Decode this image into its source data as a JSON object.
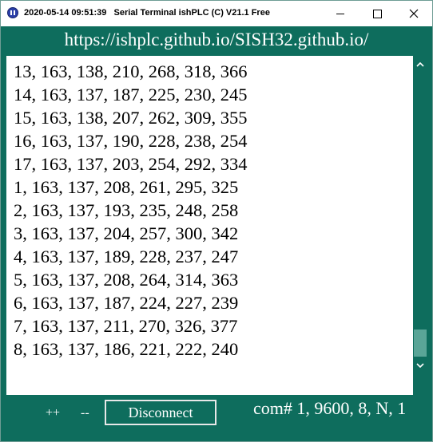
{
  "window": {
    "title": "2020-05-14 09:51:39   Serial Terminal ishPLC (C) V21.1 Free",
    "icon": "app-icon"
  },
  "header": {
    "url": "https://ishplc.github.io/SISH32.github.io/"
  },
  "terminal": {
    "lines": [
      "13, 163, 138, 210, 268, 318, 366",
      "14, 163, 137, 187, 225, 230, 245",
      "15, 163, 138, 207, 262, 309, 355",
      "16, 163, 137, 190, 228, 238, 254",
      "17, 163, 137, 203, 254, 292, 334",
      "1, 163, 137, 208, 261, 295, 325",
      "2, 163, 137, 193, 235, 248, 258",
      "3, 163, 137, 204, 257, 300, 342",
      "4, 163, 137, 189, 228, 237, 247",
      "5, 163, 137, 208, 264, 314, 363",
      "6, 163, 137, 187, 224, 227, 239",
      "7, 163, 137, 211, 270, 326, 377",
      "8, 163, 137, 186, 221, 222, 240"
    ]
  },
  "controls": {
    "plus_label": "++",
    "minus_label": "--",
    "disconnect_label": "Disconnect",
    "port_status": "com# 1, 9600, 8, N, 1"
  },
  "colors": {
    "accent": "#0e6d5d",
    "scroll_thumb": "#5aa597",
    "text_light": "#ffffff"
  }
}
